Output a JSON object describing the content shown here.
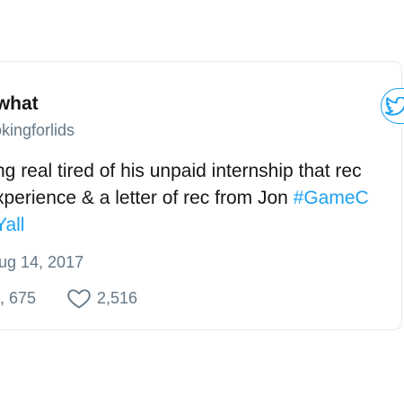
{
  "tweet": {
    "display_name": "t what",
    "handle": "okingforlids",
    "text_line1": "ng real tired of his unpaid internship that rec",
    "text_line2_plain": "xperience & a letter of rec from Jon ",
    "text_line2_hashtag": "#GameC",
    "text_line3_hashtag": "Yall",
    "date": "ug 14, 2017",
    "retweet_prefix": ",",
    "retweet_count": "675",
    "like_count": "2,516"
  },
  "colors": {
    "accent": "#1da1f2",
    "text": "#14171a",
    "muted": "#657786",
    "border": "#e6ecf0"
  },
  "icons": {
    "follow": "twitter-bird-icon",
    "like": "heart-icon"
  }
}
